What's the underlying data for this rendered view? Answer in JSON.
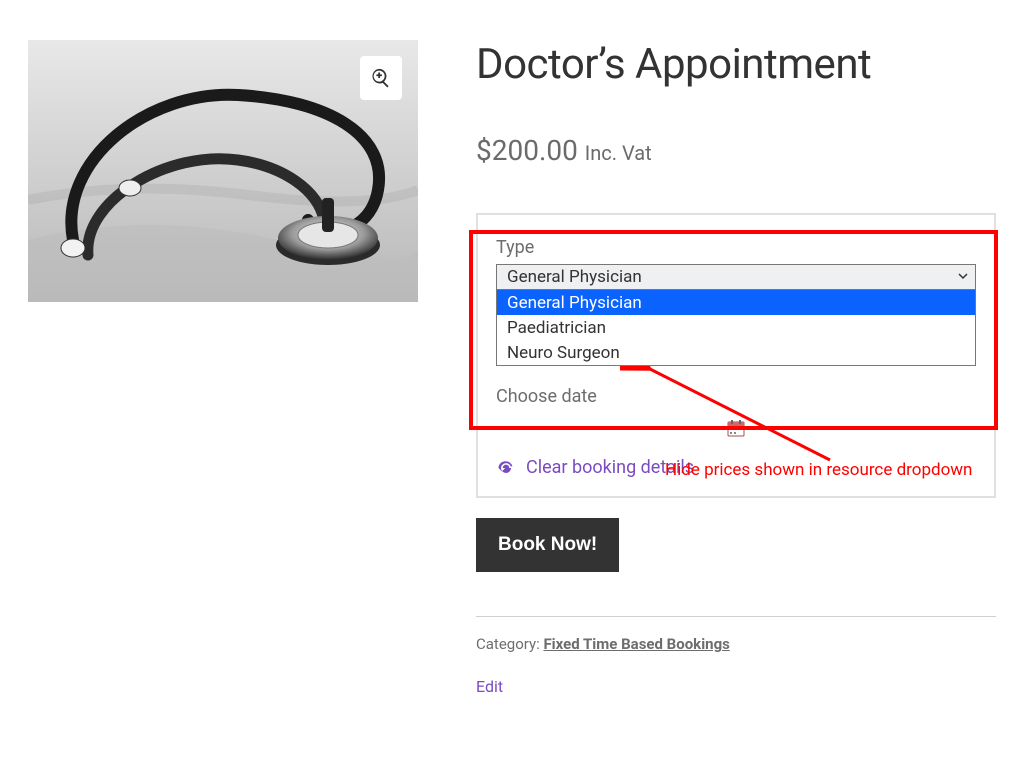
{
  "product": {
    "title": "Doctor’s Appointment",
    "price": "$200.00",
    "price_suffix": "Inc. Vat"
  },
  "booking": {
    "type_label": "Type",
    "selected_option": "General Physician",
    "options": [
      "General Physician",
      "Paediatrician",
      "Neuro Surgeon"
    ],
    "selected_index": 0,
    "choose_date_label": "Choose date",
    "clear_label": "Clear booking details"
  },
  "actions": {
    "book_label": "Book Now!"
  },
  "meta": {
    "category_prefix": "Category: ",
    "category_link": "Fixed Time Based Bookings",
    "edit_label": "Edit"
  },
  "annotation": {
    "text": "Hide prices shown in resource dropdown"
  },
  "icons": {
    "zoom": "zoom-in-icon",
    "calendar": "calendar-icon",
    "refresh": "refresh-icon",
    "chevron": "chevron-down-icon"
  }
}
